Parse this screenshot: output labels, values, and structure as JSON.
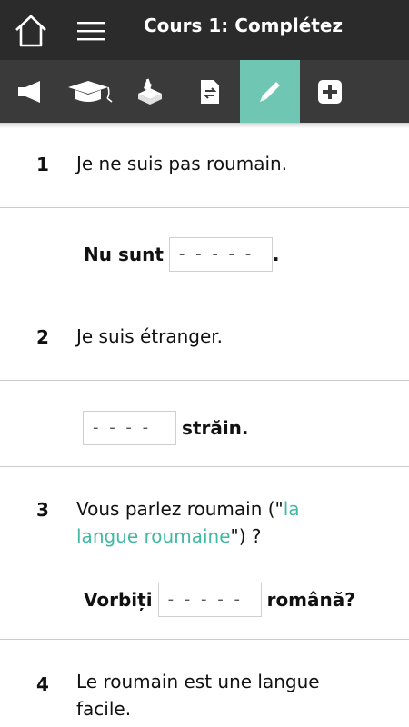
{
  "header": {
    "title": "Cours 1: Complétez"
  },
  "colors": {
    "header_bg": "#2b2b2b",
    "toolbar_bg": "#3a3a3a",
    "accent": "#6fc7b3",
    "link": "#3fb9a2"
  },
  "toolbar": {
    "items": [
      {
        "icon": "speaker-icon"
      },
      {
        "icon": "graduation-cap-icon"
      },
      {
        "icon": "vote-box-icon"
      },
      {
        "icon": "document-swap-icon"
      },
      {
        "icon": "pencil-icon",
        "active": true
      },
      {
        "icon": "plus-icon"
      }
    ]
  },
  "exercises": [
    {
      "number": "1",
      "french": "Je ne suis pas roumain.",
      "romanian_before": "Nu sunt",
      "blank": "- - - - -",
      "romanian_after": "."
    },
    {
      "number": "2",
      "french": "Je suis étranger.",
      "romanian_before": "",
      "blank": "- - - -",
      "romanian_after": "străin."
    },
    {
      "number": "3",
      "french_before": "Vous parlez roumain (\"",
      "french_link": "la langue roumaine",
      "french_after": "\") ?",
      "romanian_before": "Vorbiți",
      "blank": "- - - - -",
      "romanian_after": "română?"
    },
    {
      "number": "4",
      "french": "Le roumain est une langue facile."
    }
  ]
}
